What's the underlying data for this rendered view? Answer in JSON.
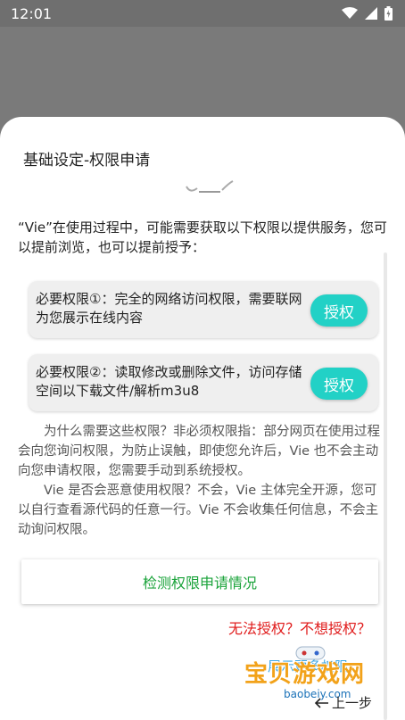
{
  "status_bar": {
    "time": "12:01",
    "icons": [
      "wifi-icon",
      "signal-icon",
      "battery-icon"
    ]
  },
  "sheet": {
    "title": "基础设定-权限申请",
    "intro": "“Vie”在使用过程中，可能需要获取以下权限以提供服务，您可以提前浏览，也可以提前授予：",
    "permissions": [
      {
        "text": "必要权限①：完全的网络访问权限，需要联网为您展示在线内容",
        "button": "授权"
      },
      {
        "text": "必要权限②：读取修改或删除文件，访问存储空间以下载文件/解析m3u8",
        "button": "授权"
      }
    ],
    "explanation_1": "为什么需要这些权限？非必须权限指：部分网页在使用过程会向您询问权限，为防止误触，即使您允许后，Vie 也不会主动向您申请权限，您需要手动到系统授权。",
    "explanation_2": "Vie 是否会恶意使用权限？不会，Vie 主体完全开源，您可以自行查看源代码的任意一行。Vie 不会收集任何信息，不会主动询问权限。",
    "check_button": "检测权限申请情况",
    "cannot_grant": "无法授权？不想授权？",
    "read_more": "展示更多权限",
    "prev_step": "上一步"
  },
  "watermark": {
    "text": "宝贝游戏网",
    "sub": "baobeiy.com"
  },
  "colors": {
    "accent": "#22d1c6",
    "check_text": "#1aa33a",
    "warning": "#e01c1c",
    "link": "#3fa7e6"
  }
}
